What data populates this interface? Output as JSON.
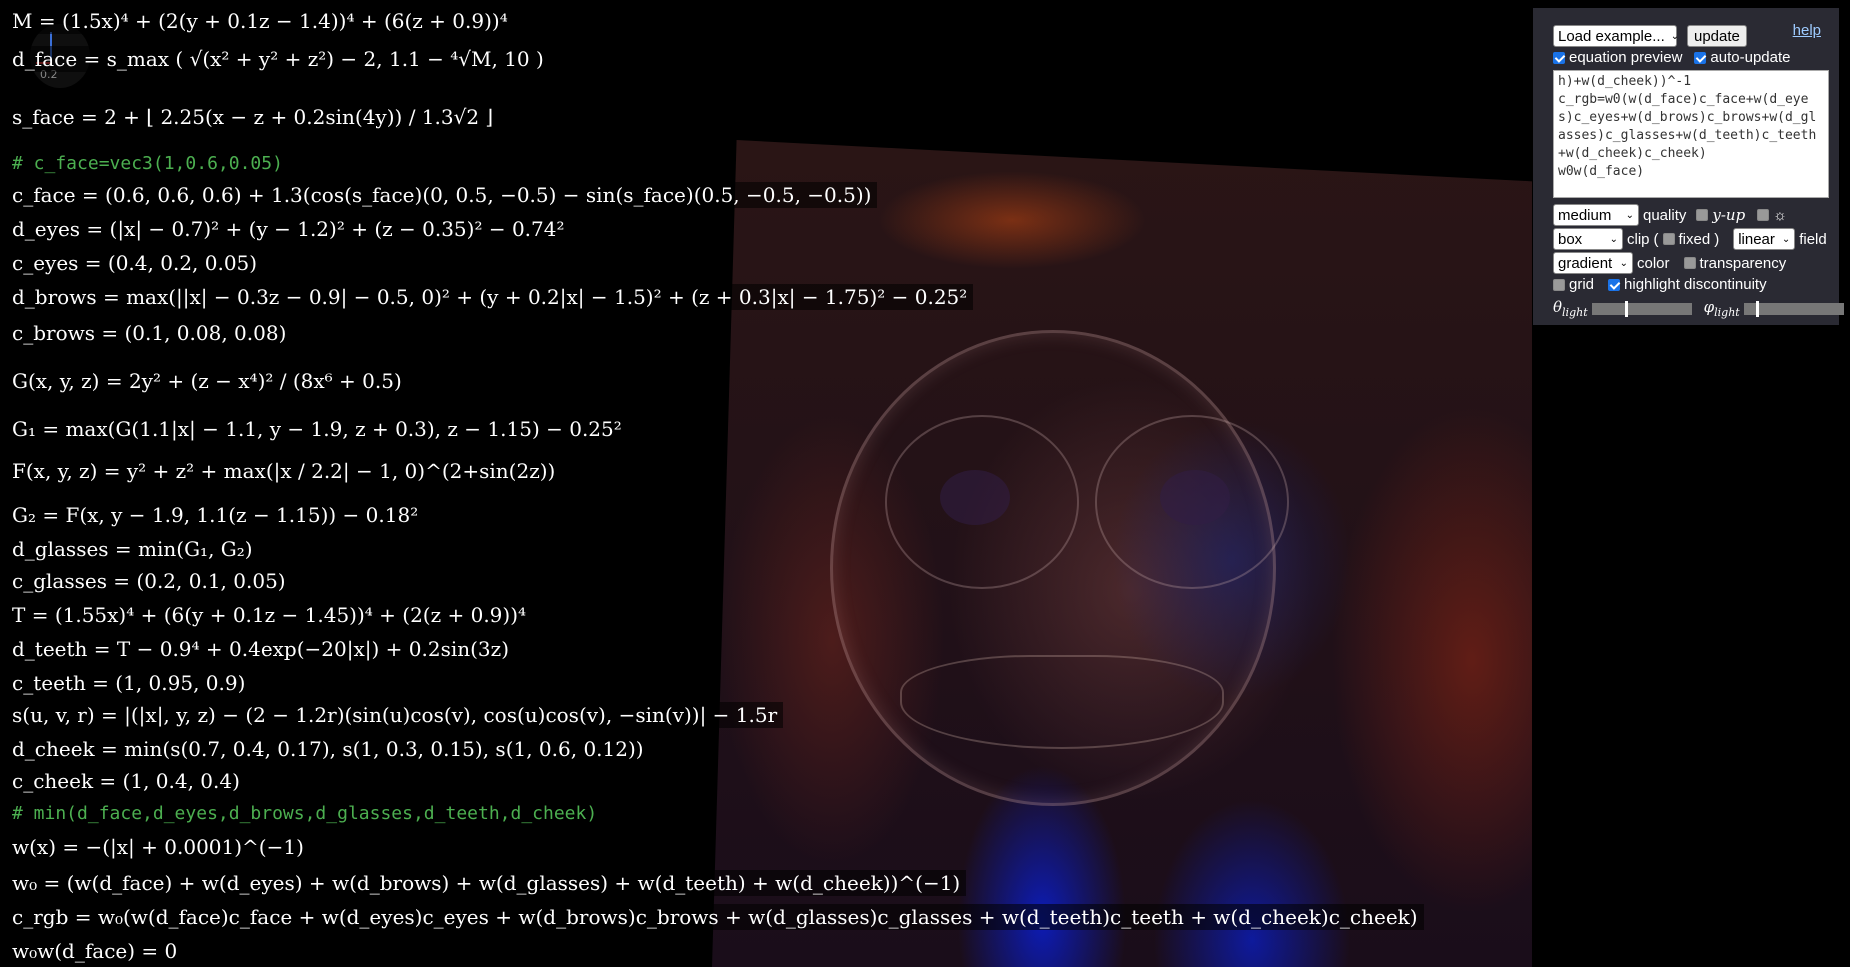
{
  "equations": [
    "M = (1.5x)⁴ + (2(y + 0.1z − 1.4))⁴ + (6(z + 0.9))⁴",
    "d_face = s_max ( √(x² + y² + z²) − 2, 1.1 − ⁴√M, 10 )",
    "s_face = 2 + ⌊ 2.25(x − z + 0.2sin(4y)) / 1.3√2 ⌋",
    "# c_face=vec3(1,0.6,0.05)",
    "c_face = (0.6, 0.6, 0.6) + 1.3(cos(s_face)(0, 0.5, −0.5) − sin(s_face)(0.5, −0.5, −0.5))",
    "d_eyes = (|x| − 0.7)² + (y − 1.2)² + (z − 0.35)² − 0.74²",
    "c_eyes = (0.4, 0.2, 0.05)",
    "d_brows = max(||x| − 0.3z − 0.9| − 0.5, 0)² + (y + 0.2|x| − 1.5)² + (z + 0.3|x| − 1.75)² − 0.25²",
    "c_brows = (0.1, 0.08, 0.08)",
    "G(x, y, z) = 2y² + (z − x⁴)² / (8x⁶ + 0.5)",
    "G₁ = max(G(1.1|x| − 1.1, y − 1.9, z + 0.3), z − 1.15) − 0.25²",
    "F(x, y, z) = y² + z² + max(|x / 2.2| − 1, 0)^(2+sin(2z))",
    "G₂ = F(x, y − 1.9, 1.1(z − 1.15)) − 0.18²",
    "d_glasses = min(G₁, G₂)",
    "c_glasses = (0.2, 0.1, 0.05)",
    "T = (1.55x)⁴ + (6(y + 0.1z − 1.45))⁴ + (2(z + 0.9))⁴",
    "d_teeth = T − 0.9⁴ + 0.4exp(−20|x|) + 0.2sin(3z)",
    "c_teeth = (1, 0.95, 0.9)",
    "s(u, v, r) = |(|x|, y, z) − (2 − 1.2r)(sin(u)cos(v), cos(u)cos(v), −sin(v))| − 1.5r",
    "d_cheek = min(s(0.7, 0.4, 0.17), s(1, 0.3, 0.15), s(1, 0.6, 0.12))",
    "c_cheek = (1, 0.4, 0.4)",
    "# min(d_face,d_eyes,d_brows,d_glasses,d_teeth,d_cheek)",
    "w(x) = −(|x| + 0.0001)^(−1)",
    "w₀ = (w(d_face) + w(d_eyes) + w(d_brows) + w(d_glasses) + w(d_teeth) + w(d_cheek))^(−1)",
    "c_rgb = w₀(w(d_face)c_face + w(d_eyes)c_eyes + w(d_brows)c_brows + w(d_glasses)c_glasses + w(d_teeth)c_teeth + w(d_cheek)c_cheek)",
    "w₀w(d_face) = 0"
  ],
  "axis_label": "0.2",
  "panel": {
    "load_example": "Load example...",
    "update": "update",
    "help": "help",
    "equation_preview": "equation preview",
    "auto_update": "auto-update",
    "code": "h)+w(d_cheek))^-1\nc_rgb=w0(w(d_face)c_face+w(d_eyes)c_eyes+w(d_brows)c_brows+w(d_glasses)c_glasses+w(d_teeth)c_teeth+w(d_cheek)c_cheek)\nw0w(d_face)",
    "quality_value": "medium",
    "quality_label": "quality",
    "y_up": "y-up",
    "sun_icon": "☼",
    "clip_value": "box",
    "clip_label": "clip",
    "fixed_label": "fixed",
    "field_value": "linear",
    "field_label": "field",
    "color_value": "gradient",
    "color_label": "color",
    "transparency": "transparency",
    "grid": "grid",
    "highlight_discontinuity": "highlight discontinuity",
    "theta_label": "θ",
    "theta_sub": "light",
    "phi_label": "φ",
    "phi_sub": "light",
    "theta_value": 0.33,
    "phi_value": 0.12
  },
  "checks": {
    "equation_preview": true,
    "auto_update": true,
    "y_up": false,
    "sun": false,
    "fixed": false,
    "transparency": false,
    "grid": false,
    "highlight_discontinuity": true
  }
}
